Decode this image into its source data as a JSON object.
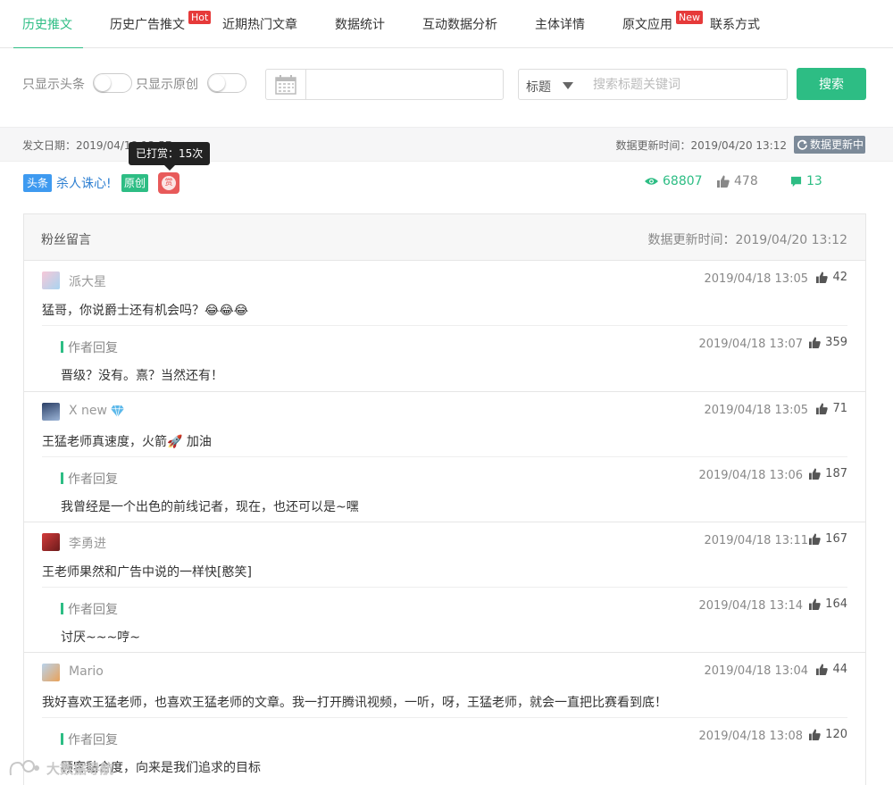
{
  "tabs": [
    {
      "label": "历史推文",
      "active": true
    },
    {
      "label": "历史广告推文",
      "badge": "Hot"
    },
    {
      "label": "近期热门文章"
    },
    {
      "label": "数据统计"
    },
    {
      "label": "互动数据分析"
    },
    {
      "label": "主体详情"
    },
    {
      "label": "原文应用",
      "badge": "New"
    },
    {
      "label": "联系方式"
    }
  ],
  "filters": {
    "headline_only": "只显示头条",
    "original_only": "只显示原创",
    "date_value": "",
    "select_value": "标题",
    "search_placeholder": "搜索标题关键词",
    "search_button": "搜索"
  },
  "info": {
    "publish_date": "发文日期：2019/04/18 13:57",
    "update_time": "数据更新时间：2019/04/20 13:12",
    "updating_badge": "数据更新中"
  },
  "tooltip": "已打赏：15次",
  "article": {
    "tag_headline": "头条",
    "title": "杀人诛心!",
    "tag_original": "原创",
    "reward_icon_char": "赏",
    "views": "68807",
    "likes": "478",
    "comments": "13"
  },
  "panel": {
    "title": "粉丝留言",
    "update_time": "数据更新时间：2019/04/20 13:12"
  },
  "comments": [
    {
      "name": "派大星",
      "time": "2019/04/18 13:05",
      "likes": "42",
      "text": "猛哥，你说爵士还有机会吗？😂😂😂",
      "reply": {
        "label": "作者回复",
        "time": "2019/04/18 13:07",
        "likes": "359",
        "text": "晋级？没有。熹？当然还有！"
      }
    },
    {
      "name": "X new",
      "time": "2019/04/18 13:05",
      "likes": "71",
      "text": "王猛老师真速度，火箭🚀 加油",
      "reply": {
        "label": "作者回复",
        "time": "2019/04/18 13:06",
        "likes": "187",
        "text": "我曾经是一个出色的前线记者，现在，也还可以是~嘿"
      }
    },
    {
      "name": "李勇进",
      "time": "2019/04/18 13:11",
      "likes": "167",
      "text": "王老师果然和广告中说的一样快[憨笑]",
      "reply": {
        "label": "作者回复",
        "time": "2019/04/18 13:14",
        "likes": "164",
        "text": "讨厌~~~哼~"
      }
    },
    {
      "name": "Mario",
      "time": "2019/04/18 13:04",
      "likes": "44",
      "text": "我好喜欢王猛老师，也喜欢王猛老师的文章。我一打开腾讯视频，一听，呀，王猛老师，就会一直把比赛看到底！",
      "reply": {
        "label": "作者回复",
        "time": "2019/04/18 13:08",
        "likes": "120",
        "text": "顾客黏合度，向来是我们追求的目标"
      }
    }
  ],
  "watermark": "大数据导航",
  "colors": {
    "accent": "#2dbd84",
    "link": "#2d7fd1",
    "hot": "#e63a3a",
    "badge_grey": "#7c8a99"
  }
}
